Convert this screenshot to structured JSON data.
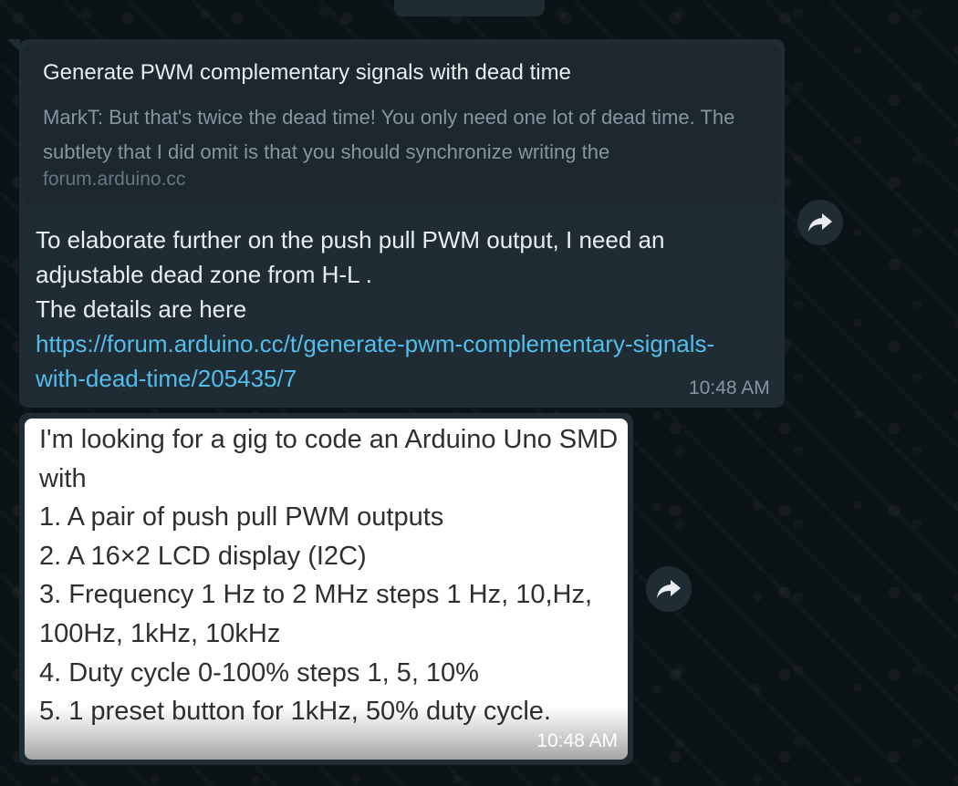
{
  "link_preview": {
    "title": "Generate PWM complementary signals with dead time",
    "description": "MarkT: But that's twice the dead time! You only need one lot of dead time. The subtlety that I did omit is that you should synchronize writing the",
    "domain": "forum.arduino.cc"
  },
  "message1": {
    "line1": "To elaborate further on the push pull PWM output, I need an adjustable dead zone from H-L .",
    "line2": "The details are here",
    "url": "https://forum.arduino.cc/t/generate-pwm-complementary-signals-with-dead-time/205435/7",
    "time": "10:48 AM"
  },
  "message2": {
    "image_lines": [
      "I'm looking for a gig to code an Arduino Uno SMD with",
      "1. A pair of push pull PWM outputs",
      "2. A 16×2 LCD display (I2C)",
      "3. Frequency 1 Hz to 2 MHz steps 1 Hz, 10,Hz, 100Hz, 1kHz, 10kHz",
      "4. Duty cycle 0-100% steps 1, 5, 10%",
      "5. 1 preset button for 1kHz, 50% duty cycle."
    ],
    "time": "10:48 AM"
  },
  "icons": {
    "forward": "forward-arrow-icon"
  },
  "colors": {
    "bubble": "#202c33",
    "link": "#53bdeb",
    "background": "#0b141a"
  }
}
